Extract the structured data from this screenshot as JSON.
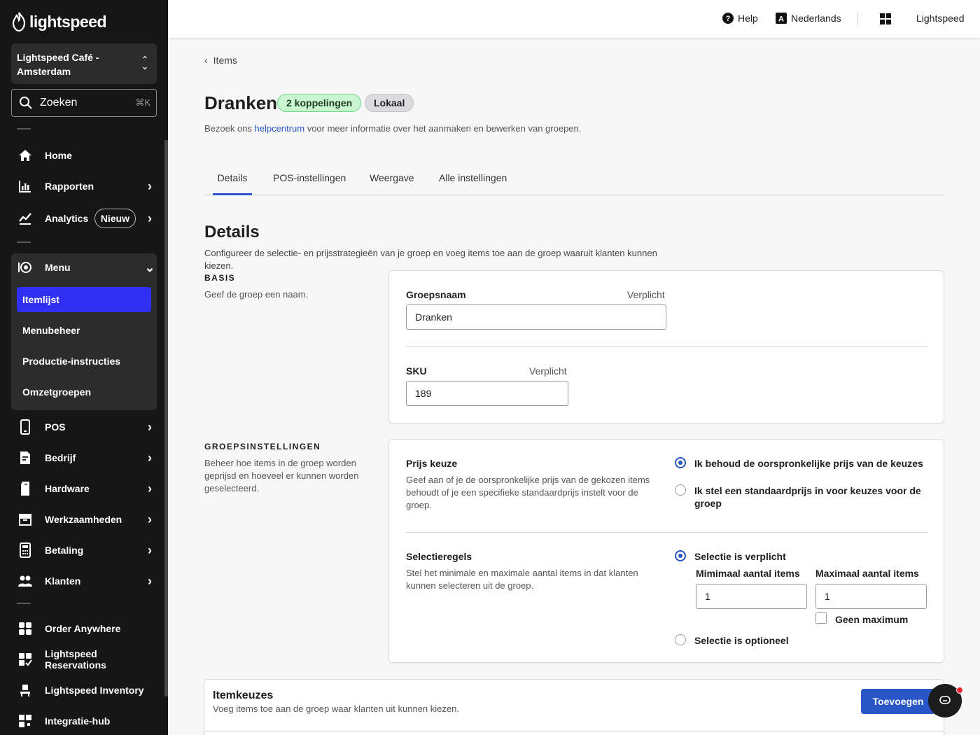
{
  "sidebar": {
    "brand": "lightspeed",
    "store": "Lightspeed Café - Amsterdam",
    "search": {
      "label": "Zoeken",
      "shortcut": "⌘K"
    },
    "items": {
      "home": "Home",
      "rapporten": "Rapporten",
      "analytics": "Analytics",
      "analytics_badge": "Nieuw",
      "menu": "Menu",
      "pos": "POS",
      "bedrijf": "Bedrijf",
      "hardware": "Hardware",
      "werkzaamheden": "Werkzaamheden",
      "betaling": "Betaling",
      "klanten": "Klanten",
      "order_anywhere": "Order Anywhere",
      "reservations": "Lightspeed Reservations",
      "inventory": "Lightspeed Inventory",
      "integratie": "Integratie-hub"
    },
    "menu_sub": [
      "Itemlijst",
      "Menubeheer",
      "Productie-instructies",
      "Omzetgroepen"
    ]
  },
  "topbar": {
    "help": "Help",
    "language": "Nederlands",
    "account": "Lightspeed"
  },
  "page": {
    "breadcrumb": "Items",
    "title": "Dranken",
    "badge_links": "2 koppelingen",
    "badge_local": "Lokaal",
    "help_prefix": "Bezoek ons ",
    "help_link": "helpcentrum",
    "help_suffix": " voor meer informatie over het aanmaken en bewerken van groepen."
  },
  "tabs": [
    "Details",
    "POS-instellingen",
    "Weergave",
    "Alle instellingen"
  ],
  "details": {
    "heading": "Details",
    "description": "Configureer de selectie- en prijsstrategieën van je groep en voeg items toe aan de groep waaruit klanten kunnen kiezen."
  },
  "basis": {
    "label": "BASIS",
    "description": "Geef de groep een naam.",
    "groepsnaam_label": "Groepsnaam",
    "groepsnaam_required": "Verplicht",
    "groepsnaam_value": "Dranken",
    "sku_label": "SKU",
    "sku_required": "Verplicht",
    "sku_value": "189"
  },
  "groepsinstellingen": {
    "label": "GROEPSINSTELLINGEN",
    "description": "Beheer hoe items in de groep worden geprijsd en hoeveel er kunnen worden geselecteerd.",
    "prijs_title": "Prijs keuze",
    "prijs_desc": "Geef aan of je de oorspronkelijke prijs van de gekozen items behoudt of je een specifieke standaardprijs instelt voor de groep.",
    "prijs_option_1": "Ik behoud de oorspronkelijke prijs van de keuzes",
    "prijs_option_2": "Ik stel een standaardprijs in voor keuzes voor de groep",
    "selectie_title": "Selectieregels",
    "selectie_desc": "Stel het minimale en maximale aantal items in dat klanten kunnen selecteren uit de groep.",
    "selectie_option_1": "Selectie is verplicht",
    "min_label": "Mimimaal aantal items",
    "min_value": "1",
    "max_label": "Maximaal aantal items",
    "max_value": "1",
    "no_max": "Geen maximum",
    "selectie_option_2": "Selectie is optioneel"
  },
  "itemkeuzes": {
    "title": "Itemkeuzes",
    "description": "Voeg items toe aan de groep waar klanten uit kunnen kiezen.",
    "add_button": "Toevoegen"
  },
  "colors": {
    "accent": "#2856c7",
    "active_nav": "#2f2ff2",
    "sidebar_bg": "#161616",
    "badge_green": "#c9f5d1"
  }
}
